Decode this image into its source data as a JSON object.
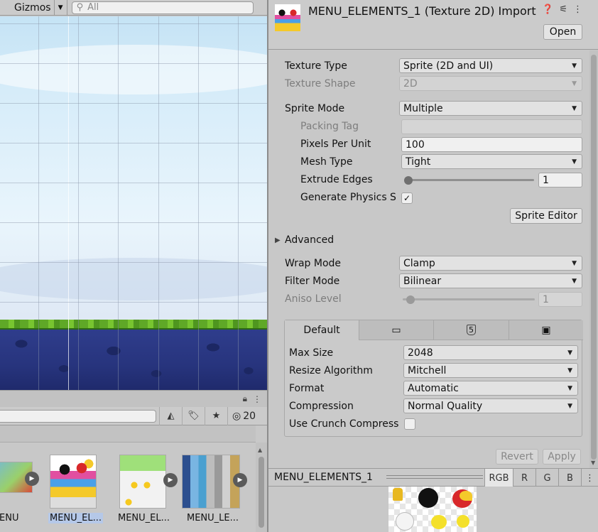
{
  "scene": {
    "gizmos_label": "Gizmos",
    "search_placeholder": "All"
  },
  "project": {
    "hidden_count": "20",
    "assets": [
      {
        "label": "ENU"
      },
      {
        "label": "MENU_EL..."
      },
      {
        "label": "MENU_EL..."
      },
      {
        "label": "MENU_LE..."
      }
    ]
  },
  "inspector": {
    "title": "MENU_ELEMENTS_1 (Texture 2D) Import",
    "open_button": "Open",
    "fields": {
      "texture_type": {
        "label": "Texture Type",
        "value": "Sprite (2D and UI)"
      },
      "texture_shape": {
        "label": "Texture Shape",
        "value": "2D"
      },
      "sprite_mode": {
        "label": "Sprite Mode",
        "value": "Multiple"
      },
      "packing_tag": {
        "label": "Packing Tag",
        "value": ""
      },
      "pixels_per_unit": {
        "label": "Pixels Per Unit",
        "value": "100"
      },
      "mesh_type": {
        "label": "Mesh Type",
        "value": "Tight"
      },
      "extrude_edges": {
        "label": "Extrude Edges",
        "value": "1",
        "slider_fraction": 0.02
      },
      "generate_physics": {
        "label": "Generate Physics S",
        "checked": true,
        "check_glyph": "✓"
      },
      "sprite_editor_button": "Sprite Editor",
      "advanced": {
        "label": "Advanced"
      },
      "wrap_mode": {
        "label": "Wrap Mode",
        "value": "Clamp"
      },
      "filter_mode": {
        "label": "Filter Mode",
        "value": "Bilinear"
      },
      "aniso_level": {
        "label": "Aniso Level",
        "value": "1",
        "slider_fraction": 0.06
      }
    },
    "platform_tabs": [
      {
        "label": "Default",
        "active": true
      },
      {
        "icon": "monitor-icon",
        "glyph": "🖵"
      },
      {
        "icon": "html5-icon",
        "glyph": "5"
      },
      {
        "icon": "android-icon",
        "glyph": "🤖"
      }
    ],
    "platform": {
      "max_size": {
        "label": "Max Size",
        "value": "2048"
      },
      "resize_algorithm": {
        "label": "Resize Algorithm",
        "value": "Mitchell"
      },
      "format": {
        "label": "Format",
        "value": "Automatic"
      },
      "compression": {
        "label": "Compression",
        "value": "Normal Quality"
      },
      "use_crunch": {
        "label": "Use Crunch Compress",
        "checked": false
      }
    },
    "revert_button": "Revert",
    "apply_button": "Apply"
  },
  "preview": {
    "title": "MENU_ELEMENTS_1",
    "channels": [
      "RGB",
      "R",
      "G",
      "B"
    ]
  },
  "colors": {
    "panel_bg": "#c8c8c8",
    "grass": "#5fa827",
    "dirt": "#27347d",
    "sky": "#d6ecf9"
  }
}
